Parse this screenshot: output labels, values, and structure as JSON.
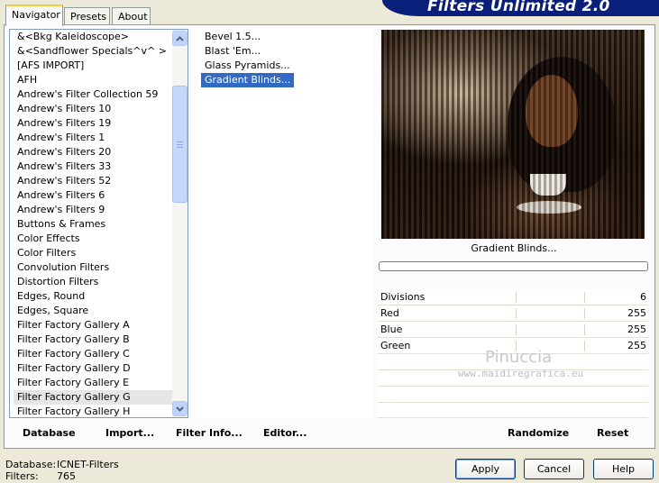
{
  "banner": {
    "title": "Filters Unlimited 2.0"
  },
  "tabs": [
    {
      "label": "Navigator",
      "active": true
    },
    {
      "label": "Presets",
      "active": false
    },
    {
      "label": "About",
      "active": false
    }
  ],
  "categories": {
    "items": [
      "&<Bkg Kaleidoscope>",
      "&<Sandflower Specials^v^ >",
      "[AFS IMPORT]",
      "AFH",
      "Andrew's Filter Collection 59",
      "Andrew's Filters 10",
      "Andrew's Filters 19",
      "Andrew's Filters 1",
      "Andrew's Filters 20",
      "Andrew's Filters 33",
      "Andrew's Filters 52",
      "Andrew's Filters 6",
      "Andrew's Filters 9",
      "Buttons & Frames",
      "Color Effects",
      "Color Filters",
      "Convolution Filters",
      "Distortion Filters",
      "Edges, Round",
      "Edges, Square",
      "Filter Factory Gallery A",
      "Filter Factory Gallery B",
      "Filter Factory Gallery C",
      "Filter Factory Gallery D",
      "Filter Factory Gallery E",
      "Filter Factory Gallery G",
      "Filter Factory Gallery H"
    ],
    "selected": "Filter Factory Gallery G"
  },
  "filters": {
    "items": [
      "Bevel 1.5...",
      "Blast 'Em...",
      "Glass Pyramids...",
      "Gradient Blinds..."
    ],
    "selected": "Gradient Blinds..."
  },
  "tab_buttons": {
    "database_label": "Database",
    "import_label": "Import...",
    "filter_info_label": "Filter Info...",
    "editor_label": "Editor...",
    "randomize_label": "Randomize",
    "reset_label": "Reset"
  },
  "preview": {
    "caption": "Gradient Blinds...",
    "progress": 0
  },
  "params": [
    {
      "label": "Divisions",
      "value": "6"
    },
    {
      "label": "Red",
      "value": "255"
    },
    {
      "label": "Blue",
      "value": "255"
    },
    {
      "label": "Green",
      "value": "255"
    }
  ],
  "watermark": {
    "name": "Pinuccia",
    "url": "www.maidiregrafica.eu"
  },
  "status": {
    "database_label": "Database:",
    "database_value": "ICNET-Filters",
    "filters_label": "Filters:",
    "filters_value": "765"
  },
  "dialog_buttons": {
    "apply": "Apply",
    "cancel": "Cancel",
    "help": "Help"
  },
  "colors": {
    "selection": "#316AC5",
    "banner": "#0A1F7A",
    "face": "#ECE9D8"
  }
}
